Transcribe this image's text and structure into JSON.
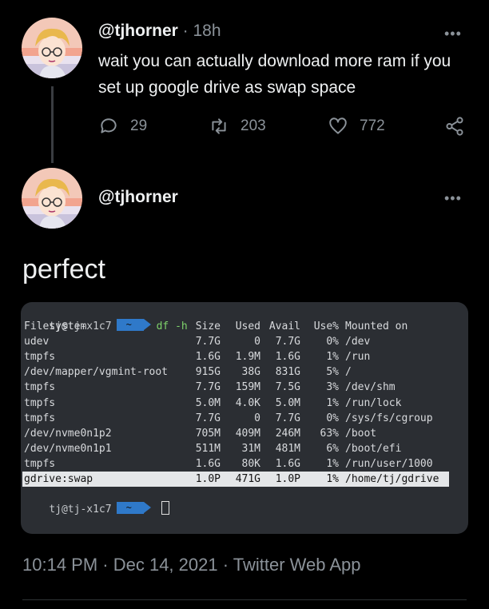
{
  "reply_tweet": {
    "handle": "@tjhorner",
    "separator": "·",
    "time": "18h",
    "more": "•••",
    "text": "wait you can actually download more ram if you set up google drive as swap space",
    "actions": {
      "reply_icon": "reply-icon",
      "reply_count": "29",
      "retweet_icon": "retweet-icon",
      "retweet_count": "203",
      "like_icon": "heart-icon",
      "like_count": "772",
      "share_icon": "share-icon"
    }
  },
  "main_tweet": {
    "handle": "@tjhorner",
    "more": "•••",
    "text": "perfect",
    "timestamp": "10:14 PM · Dec 14, 2021 · Twitter Web App"
  },
  "terminal": {
    "prompt_user": "tj@tj-x1c7",
    "prompt_dir": "~",
    "command": "df -h",
    "headers": [
      "Filesystem",
      "Size",
      "Used",
      "Avail",
      "Use%",
      "Mounted on"
    ],
    "rows": [
      [
        "udev",
        "7.7G",
        "0",
        "7.7G",
        "0%",
        "/dev"
      ],
      [
        "tmpfs",
        "1.6G",
        "1.9M",
        "1.6G",
        "1%",
        "/run"
      ],
      [
        "/dev/mapper/vgmint-root",
        "915G",
        "38G",
        "831G",
        "5%",
        "/"
      ],
      [
        "tmpfs",
        "7.7G",
        "159M",
        "7.5G",
        "3%",
        "/dev/shm"
      ],
      [
        "tmpfs",
        "5.0M",
        "4.0K",
        "5.0M",
        "1%",
        "/run/lock"
      ],
      [
        "tmpfs",
        "7.7G",
        "0",
        "7.7G",
        "0%",
        "/sys/fs/cgroup"
      ],
      [
        "/dev/nvme0n1p2",
        "705M",
        "409M",
        "246M",
        "63%",
        "/boot"
      ],
      [
        "/dev/nvme0n1p1",
        "511M",
        "31M",
        "481M",
        "6%",
        "/boot/efi"
      ],
      [
        "tmpfs",
        "1.6G",
        "80K",
        "1.6G",
        "1%",
        "/run/user/1000"
      ],
      [
        "gdrive:swap",
        "1.0P",
        "471G",
        "1.0P",
        "1%",
        "/home/tj/gdrive"
      ]
    ],
    "highlighted_row_index": 9
  }
}
